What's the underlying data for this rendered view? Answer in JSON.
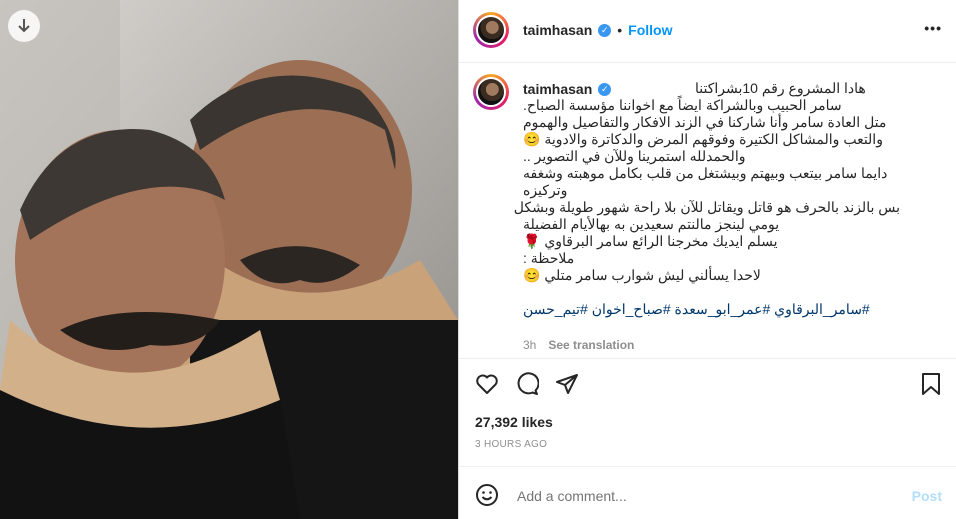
{
  "post": {
    "username": "taimhasan",
    "follow_label": "Follow",
    "options_label": "•••",
    "caption_lines": [
      "هادا المشروع رقم 10بشراكتنا",
      "سامر الحبيب وبالشراكة ايضاً مع اخواننا مؤسسة الصباح.",
      "متل العادة سامر وأنا شاركنا في الزند الافكار والتفاصيل والهموم",
      "والتعب والمشاكل الكتيرة وفوقهم المرض والدكاترة والادوية 😊",
      "والحمدلله استمرينا وللآن في التصوير ..",
      "دايما سامر بيتعب وبيهتم وبيشتغل من قلب بكامل موهبته وشغفه",
      "وتركيزه",
      "بس بالزند بالحرف هو قاتل ويقاتل للآن بلا راحة شهور طويلة وبشكل",
      "يومي لينجز مالنتم سعيدين به بهالأيام الفضيلة",
      "يسلم ايديك مخرجنا الرائع سامر البرقاوي 🌹",
      "ملاحظة :",
      "لاحدا يسألني ليش شوارب سامر متلي 😊"
    ],
    "hashtags": "#سامر_البرقاوي #عمر_ابو_سعدة #صباح_اخوان #تيم_حسن",
    "time_ago": "3h",
    "see_translation": "See translation",
    "likes": "27,392 likes",
    "posted": "3 HOURS AGO",
    "comment_placeholder": "Add a comment...",
    "post_label": "Post"
  },
  "icons": {
    "download": "download-arrow-icon",
    "like": "heart-icon",
    "comment": "comment-icon",
    "share": "send-icon",
    "save": "bookmark-icon",
    "emoji": "emoji-icon",
    "verified": "verified-badge-icon"
  },
  "colors": {
    "accent": "#0095f6",
    "hashtag": "#00376b",
    "muted": "#8e8e8e",
    "verified": "#3897f0"
  }
}
